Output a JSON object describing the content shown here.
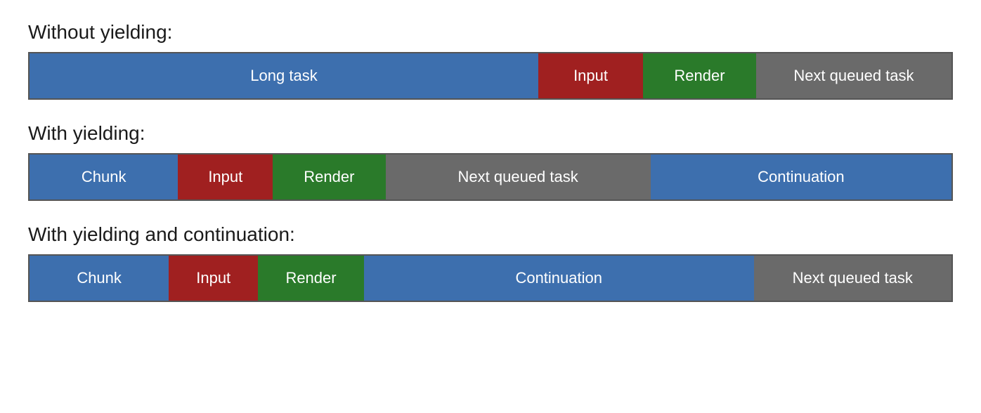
{
  "section1": {
    "title": "Without yielding:",
    "segments": [
      {
        "label": "Long task",
        "class": "blue  row1-longtask"
      },
      {
        "label": "Input",
        "class": "red   row1-input"
      },
      {
        "label": "Render",
        "class": "green row1-render"
      },
      {
        "label": "Next queued task",
        "class": "gray  row1-next"
      }
    ]
  },
  "section2": {
    "title": "With yielding:",
    "segments": [
      {
        "label": "Chunk",
        "class": "blue  row2-chunk"
      },
      {
        "label": "Input",
        "class": "red   row2-input"
      },
      {
        "label": "Render",
        "class": "green row2-render"
      },
      {
        "label": "Next queued task",
        "class": "gray  row2-next"
      },
      {
        "label": "Continuation",
        "class": "blue  row2-cont"
      }
    ]
  },
  "section3": {
    "title": "With yielding and continuation:",
    "segments": [
      {
        "label": "Chunk",
        "class": "blue  row3-chunk"
      },
      {
        "label": "Input",
        "class": "red   row3-input"
      },
      {
        "label": "Render",
        "class": "green row3-render"
      },
      {
        "label": "Continuation",
        "class": "blue  row3-cont"
      },
      {
        "label": "Next queued task",
        "class": "gray  row3-next"
      }
    ]
  }
}
